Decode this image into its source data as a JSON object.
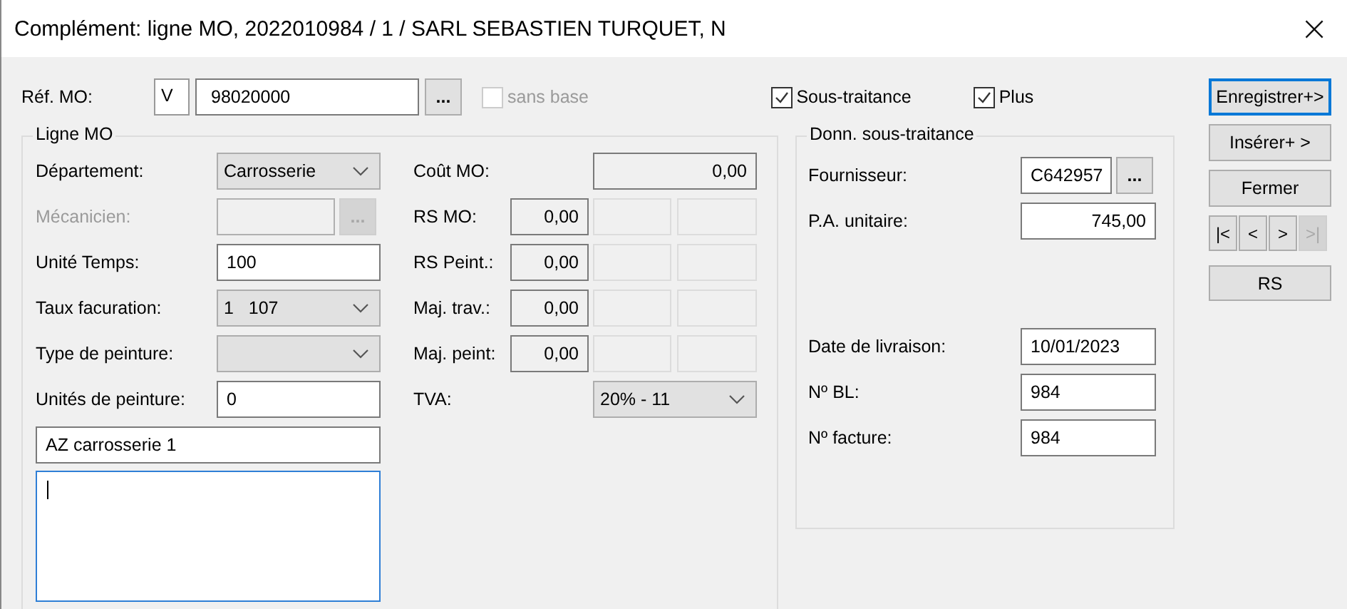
{
  "window": {
    "title": "Complément: ligne MO, 2022010984 / 1 / SARL SEBASTIEN TURQUET, N",
    "close": "×"
  },
  "ref": {
    "label": "Réf. MO:",
    "prefix": "V",
    "value": "98020000",
    "browse": "...",
    "sans_base": {
      "label": "sans base",
      "checked": false,
      "disabled": true
    }
  },
  "top_checks": [
    {
      "label": "Sous-traitance",
      "checked": true
    },
    {
      "label": "Plus",
      "checked": true
    }
  ],
  "ligne_mo": {
    "title": "Ligne MO",
    "left_rows": [
      {
        "label": "Département:",
        "kind": "select",
        "value": "Carrosserie"
      },
      {
        "label": "Mécanicien:",
        "kind": "browse",
        "value": "",
        "browse": "...",
        "disabled": true
      },
      {
        "label": "Unité Temps:",
        "kind": "text",
        "value": "100"
      },
      {
        "label": "Taux facuration:",
        "kind": "select",
        "value": "1   107"
      },
      {
        "label": "Type de peinture:",
        "kind": "select",
        "value": ""
      },
      {
        "label": "Unités de peinture:",
        "kind": "text",
        "value": "0"
      }
    ],
    "right_rows": [
      {
        "label": "Coût MO:",
        "kind": "wide",
        "value": "0,00"
      },
      {
        "label": "RS MO:",
        "kind": "triple",
        "value": "0,00"
      },
      {
        "label": "RS Peint.:",
        "kind": "triple",
        "value": "0,00"
      },
      {
        "label": "Maj. trav.:",
        "kind": "triple",
        "value": "0,00"
      },
      {
        "label": "Maj. peint:",
        "kind": "triple",
        "value": "0,00"
      },
      {
        "label": "TVA:",
        "kind": "select",
        "value": "20% - 11"
      }
    ],
    "description": "AZ carrosserie 1",
    "notes": {
      "focused": true
    }
  },
  "sous_traitance": {
    "title": "Donn. sous-traitance",
    "fields_top": [
      {
        "label": "Fournisseur:",
        "value": "C642957",
        "kind": "browse",
        "browse": "..."
      },
      {
        "label": "P.A. unitaire:",
        "value": "745,00",
        "kind": "amount"
      }
    ],
    "fields_bottom": [
      {
        "label": "Date de livraison:",
        "value": "10/01/2023"
      },
      {
        "label": "Nº BL:",
        "value": "984"
      },
      {
        "label": "Nº facture:",
        "value": "984"
      }
    ]
  },
  "buttons": [
    {
      "label": "Enregistrer+>",
      "focused": true
    },
    {
      "label": "Insérer+ >",
      "focused": false
    },
    {
      "label": "Fermer",
      "focused": false
    }
  ],
  "nav": [
    {
      "label": "|<",
      "disabled": false
    },
    {
      "label": "<",
      "disabled": false
    },
    {
      "label": ">",
      "disabled": false
    },
    {
      "label": ">|",
      "disabled": true
    }
  ],
  "extra_button": {
    "label": "RS"
  }
}
